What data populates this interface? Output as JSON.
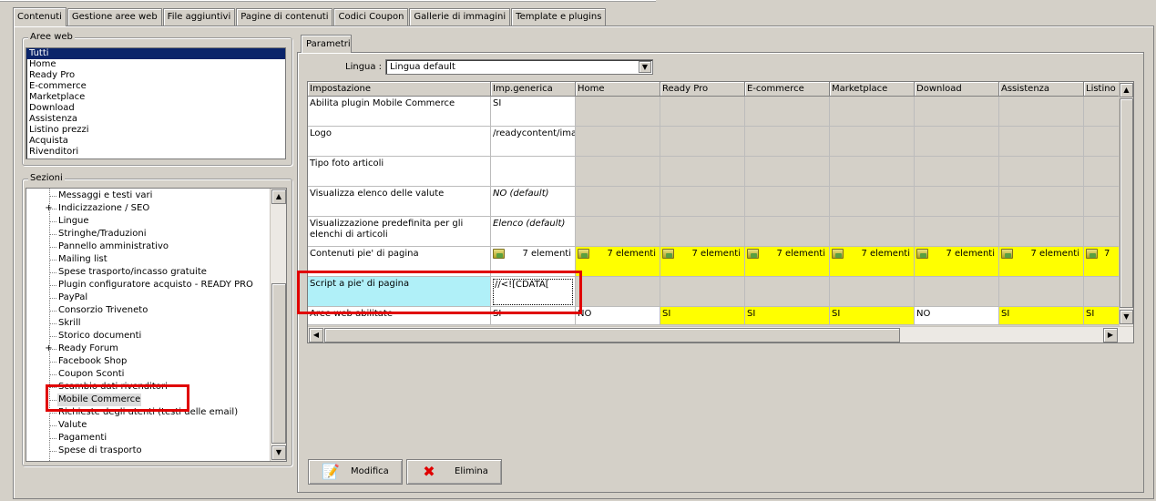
{
  "tabs": [
    "Contenuti",
    "Gestione aree web",
    "File aggiuntivi",
    "Pagine di contenuti",
    "Codici Coupon",
    "Gallerie di immagini",
    "Template e plugins"
  ],
  "aree_web": {
    "title": "Aree web",
    "items": [
      "Tutti",
      "Home",
      "Ready Pro",
      "E-commerce",
      "Marketplace",
      "Download",
      "Assistenza",
      "Listino prezzi",
      "Acquista",
      "Rivenditori"
    ],
    "selected_index": 0
  },
  "sezioni": {
    "title": "Sezioni",
    "items": [
      {
        "label": "Messaggi e testi vari",
        "expandable": false
      },
      {
        "label": "Indicizzazione / SEO",
        "expandable": true
      },
      {
        "label": "Lingue",
        "expandable": false
      },
      {
        "label": "Stringhe/Traduzioni",
        "expandable": false
      },
      {
        "label": "Pannello amministrativo",
        "expandable": false
      },
      {
        "label": "Mailing list",
        "expandable": false
      },
      {
        "label": "Spese trasporto/incasso gratuite",
        "expandable": false
      },
      {
        "label": "Plugin configuratore acquisto - READY PRO",
        "expandable": false
      },
      {
        "label": "PayPal",
        "expandable": false
      },
      {
        "label": "Consorzio Triveneto",
        "expandable": false
      },
      {
        "label": "Skrill",
        "expandable": false
      },
      {
        "label": "Storico documenti",
        "expandable": false
      },
      {
        "label": "Ready Forum",
        "expandable": true
      },
      {
        "label": "Facebook Shop",
        "expandable": false
      },
      {
        "label": "Coupon Sconti",
        "expandable": false
      },
      {
        "label": "Scambio dati rivenditori",
        "expandable": false
      },
      {
        "label": "Mobile Commerce",
        "expandable": false
      },
      {
        "label": "Richieste degli utenti (testi delle email)",
        "expandable": false
      },
      {
        "label": "Valute",
        "expandable": false
      },
      {
        "label": "Pagamenti",
        "expandable": false
      },
      {
        "label": "Spese di trasporto",
        "expandable": false
      }
    ],
    "highlighted_index": 16
  },
  "parametri": {
    "tab_label": "Parametri",
    "lingua_label": "Lingua :",
    "lingua_value": "Lingua default"
  },
  "grid": {
    "columns": [
      "Impostazione",
      "Imp.generica",
      "Home",
      "Ready Pro",
      "E-commerce",
      "Marketplace",
      "Download",
      "Assistenza",
      "Listino p"
    ],
    "rows": [
      {
        "name": "Abilita plugin Mobile Commerce",
        "generic": "SI",
        "values": [
          "",
          "",
          "",
          "",
          "",
          "",
          ""
        ],
        "style": "plain"
      },
      {
        "name": "Logo",
        "generic": "/readycontent/images/logomobil…",
        "values": [
          "",
          "",
          "",
          "",
          "",
          "",
          ""
        ],
        "style": "plain"
      },
      {
        "name": "Tipo foto articoli",
        "generic": "",
        "values": [
          "",
          "",
          "",
          "",
          "",
          "",
          ""
        ],
        "style": "plain"
      },
      {
        "name": "Visualizza elenco delle valute",
        "generic": "NO (default)",
        "values": [
          "",
          "",
          "",
          "",
          "",
          "",
          ""
        ],
        "style": "italic"
      },
      {
        "name": "Visualizzazione predefinita per gli elenchi di articoli",
        "generic": "Elenco (default)",
        "values": [
          "",
          "",
          "",
          "",
          "",
          "",
          ""
        ],
        "style": "italic"
      },
      {
        "name": "Contenuti pie' di pagina",
        "generic": "7 elementi",
        "values": [
          "7 elementi",
          "7 elementi",
          "7 elementi",
          "7 elementi",
          "7 elementi",
          "7 elementi",
          "7"
        ],
        "style": "folder"
      },
      {
        "name": "Script a pie' di pagina",
        "generic": "//<![CDATA[",
        "values": [
          "",
          "",
          "",
          "",
          "",
          "",
          ""
        ],
        "style": "selected"
      },
      {
        "name": "Aree web abilitate",
        "generic": "SI",
        "values": [
          "NO",
          "SI",
          "SI",
          "SI",
          "NO",
          "SI",
          "SI"
        ],
        "style": "aree"
      }
    ]
  },
  "buttons": {
    "modifica": "Modifica",
    "elimina": "Elimina"
  },
  "colors": {
    "highlight_yellow": "#ffff00",
    "selected_cyan": "#b0f0f8",
    "annotation_red": "#e00000",
    "selection_blue": "#0a246a"
  }
}
